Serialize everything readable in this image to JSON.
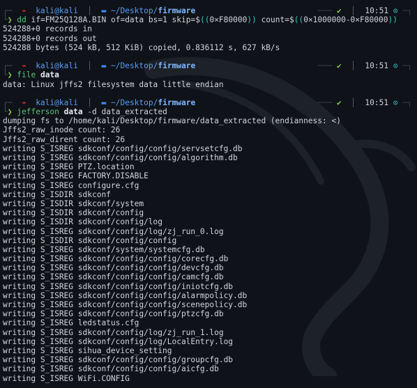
{
  "prompt": {
    "user": "kali@kali",
    "path_prefix": "~/Desktop/",
    "path_bold": "firmware",
    "status_check": "✔",
    "time": "10:51"
  },
  "blocks": [
    {
      "command": {
        "name": "dd",
        "parts": [
          {
            "text": " if=",
            "style": "arg"
          },
          {
            "text": "FM25Q128A.BIN",
            "style": "arg"
          },
          {
            "text": " of=data bs=1 skip=$",
            "style": "arg"
          },
          {
            "text": "((",
            "style": "paren2"
          },
          {
            "text": "0×F80000",
            "style": "arg"
          },
          {
            "text": "))",
            "style": "paren2"
          },
          {
            "text": " count=$",
            "style": "arg"
          },
          {
            "text": "((",
            "style": "paren2"
          },
          {
            "text": "0×1000000-0×F80000",
            "style": "arg"
          },
          {
            "text": "))",
            "style": "paren2"
          }
        ]
      },
      "output": [
        "524288+0 records in",
        "524288+0 records out",
        "524288 bytes (524 kB, 512 KiB) copied, 0.836112 s, 627 kB/s"
      ]
    },
    {
      "command": {
        "name": "file",
        "parts": [
          {
            "text": " ",
            "style": "arg"
          },
          {
            "text": "data",
            "style": "argb"
          }
        ]
      },
      "output": [
        "data: Linux jffs2 filesystem data little endian"
      ]
    },
    {
      "command": {
        "name": "jefferson",
        "parts": [
          {
            "text": " ",
            "style": "arg"
          },
          {
            "text": "data",
            "style": "argb"
          },
          {
            "text": " -d data_extracted",
            "style": "arg"
          }
        ]
      },
      "output": [
        "dumping fs to /home/kali/Desktop/firmware/data_extracted (endianness: <)",
        "Jffs2_raw_inode count: 26",
        "Jffs2_raw_dirent count: 26",
        "writing S_ISREG sdkconf/config/config/servsetcfg.db",
        "writing S_ISREG sdkconf/config/config/algorithm.db",
        "writing S_ISREG PTZ.location",
        "writing S_ISREG FACTORY.DISABLE",
        "writing S_ISREG configure.cfg",
        "writing S_ISDIR sdkconf",
        "writing S_ISDIR sdkconf/system",
        "writing S_ISDIR sdkconf/config",
        "writing S_ISDIR sdkconf/config/log",
        "writing S_ISREG sdkconf/config/log/zj_run_0.log",
        "writing S_ISDIR sdkconf/config/config",
        "writing S_ISREG sdkconf/system/systemcfg.db",
        "writing S_ISREG sdkconf/config/config/corecfg.db",
        "writing S_ISREG sdkconf/config/config/devcfg.db",
        "writing S_ISREG sdkconf/config/config/camcfg.db",
        "writing S_ISREG sdkconf/config/config/iniotcfg.db",
        "writing S_ISREG sdkconf/config/config/alarmpolicy.db",
        "writing S_ISREG sdkconf/config/config/scenepolicy.db",
        "writing S_ISREG sdkconf/config/config/ptzcfg.db",
        "writing S_ISREG ledstatus.cfg",
        "writing S_ISREG sdkconf/config/log/zj_run_1.log",
        "writing S_ISREG sdkconf/config/log/LocalEntry.log",
        "writing S_ISREG sihua_device_setting",
        "writing S_ISREG sdkconf/config/config/groupcfg.db",
        "writing S_ISREG sdkconf/config/config/aicfg.db",
        "writing S_ISREG WiFi.CONFIG"
      ]
    }
  ]
}
